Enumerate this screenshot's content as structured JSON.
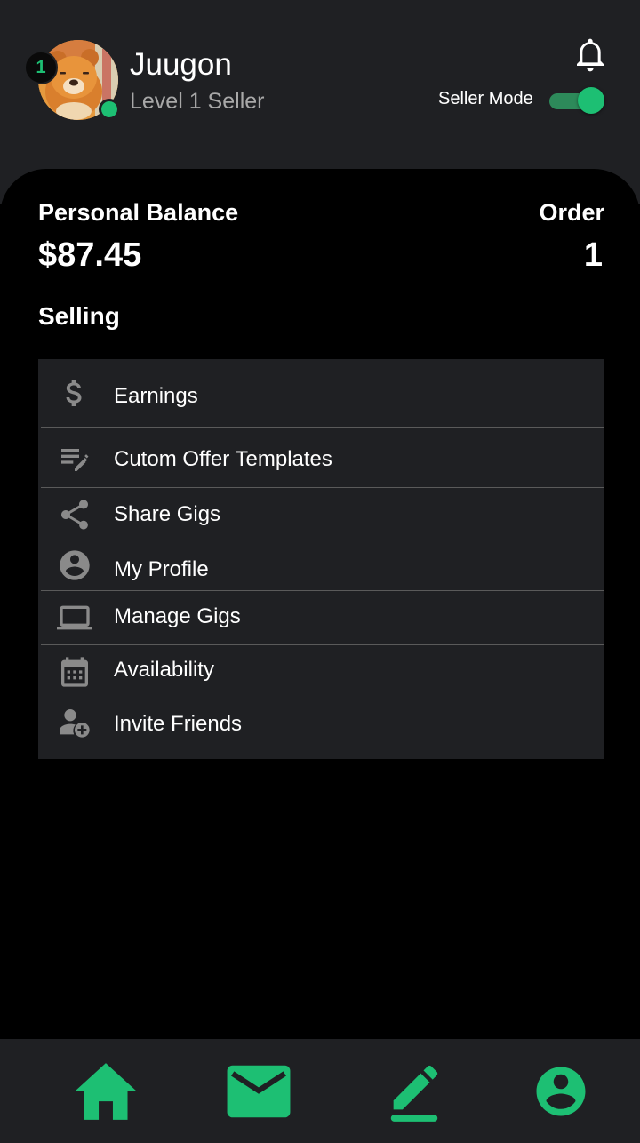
{
  "header": {
    "username": "Juugon",
    "seller_level": "Level 1 Seller",
    "level_badge": "1",
    "seller_mode_label": "Seller Mode",
    "seller_mode_on": true,
    "notification_icon": "bell-icon"
  },
  "summary": {
    "balance_label": "Personal Balance",
    "balance_value": "$87.45",
    "order_label": "Order",
    "order_value": "1"
  },
  "selling": {
    "title": "Selling",
    "items": [
      {
        "label": "Earnings",
        "icon": "dollar-icon"
      },
      {
        "label": "Cutom Offer Templates",
        "icon": "edit-list-icon"
      },
      {
        "label": "Share Gigs",
        "icon": "share-icon"
      },
      {
        "label": "My Profile",
        "icon": "account-circle-icon"
      },
      {
        "label": "Manage Gigs",
        "icon": "laptop-icon"
      },
      {
        "label": "Availability",
        "icon": "calendar-icon"
      },
      {
        "label": "Invite Friends",
        "icon": "add-person-icon"
      }
    ]
  },
  "bottom_nav": {
    "items": [
      "home-icon",
      "mail-icon",
      "edit-icon",
      "profile-icon"
    ]
  },
  "colors": {
    "accent": "#1dbf73",
    "surface": "#1f2023",
    "background": "#000000",
    "icon_gray": "#8a8a8a"
  }
}
